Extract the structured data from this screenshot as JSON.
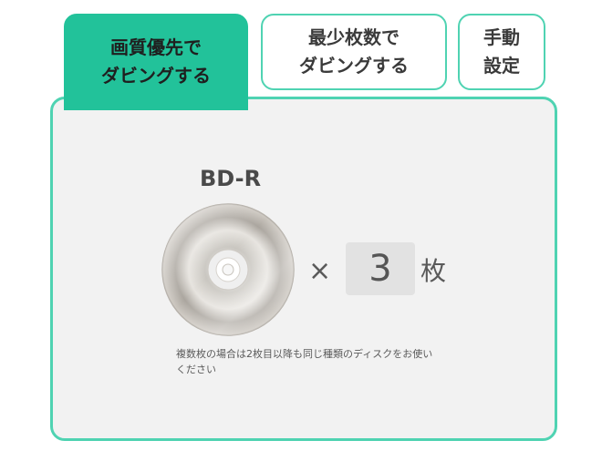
{
  "tabs": [
    {
      "label": "画質優先で\nダビングする",
      "active": true
    },
    {
      "label": "最少枚数で\nダビングする",
      "active": false
    },
    {
      "label": "手動\n設定",
      "active": false
    }
  ],
  "panel": {
    "disc_type": "BD-R",
    "times_symbol": "×",
    "count": "3",
    "unit": "枚",
    "note": "複数枚の場合は2枚目以降も同じ種類のディスクをお使いください"
  },
  "colors": {
    "accent": "#22c29a",
    "border": "#4fd3b2",
    "panel_bg": "#f2f2f2",
    "count_bg": "#e2e2e2"
  },
  "icons": {
    "disc": "bd-r-disc-icon"
  }
}
